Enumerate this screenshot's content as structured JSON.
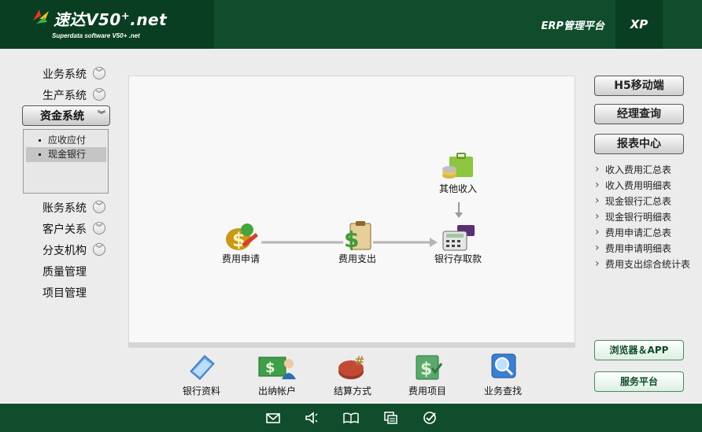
{
  "header": {
    "logo_title": "速达V50",
    "logo_title_sup": "+",
    "logo_title_suffix": ".net",
    "logo_sub": "Superdata software V50+ .net",
    "platform": "ERP管理平台",
    "xp": "XP"
  },
  "sidebar": {
    "items": [
      {
        "label": "业务系统",
        "expandable": true
      },
      {
        "label": "生产系统",
        "expandable": true
      },
      {
        "label": "资金系统",
        "expandable": true,
        "active": true
      },
      {
        "label": "账务系统",
        "expandable": true
      },
      {
        "label": "客户关系",
        "expandable": true
      },
      {
        "label": "分支机构",
        "expandable": true
      },
      {
        "label": "质量管理",
        "expandable": false
      },
      {
        "label": "项目管理",
        "expandable": false
      }
    ],
    "submenu": [
      {
        "label": "应收应付",
        "selected": false
      },
      {
        "label": "现金银行",
        "selected": true
      }
    ]
  },
  "flow": {
    "nodes": {
      "expense_apply": "费用申请",
      "expense_pay": "费用支出",
      "bank_deposit": "银行存取款",
      "other_income": "其他收入"
    }
  },
  "tools": [
    {
      "label": "银行资料",
      "icon": "document-icon"
    },
    {
      "label": "出纳帐户",
      "icon": "cash-account-icon"
    },
    {
      "label": "结算方式",
      "icon": "settlement-icon"
    },
    {
      "label": "费用项目",
      "icon": "expense-item-icon"
    },
    {
      "label": "业务查找",
      "icon": "search-icon"
    }
  ],
  "right": {
    "buttons": [
      "H5移动端",
      "经理查询",
      "报表中心"
    ],
    "reports": [
      "收入费用汇总表",
      "收入费用明细表",
      "现金银行汇总表",
      "现金银行明细表",
      "费用申请汇总表",
      "费用申请明细表",
      "费用支出综合统计表"
    ],
    "bottom_buttons": [
      "浏览器＆APP",
      "服务平台"
    ]
  },
  "footer": {
    "icons": [
      "mail-icon",
      "speaker-icon",
      "book-icon",
      "windows-icon",
      "check-icon"
    ]
  },
  "colors": {
    "header_bg": "#0f4d2c",
    "header_dark": "#0a3e22",
    "body_bg": "#ececec"
  }
}
